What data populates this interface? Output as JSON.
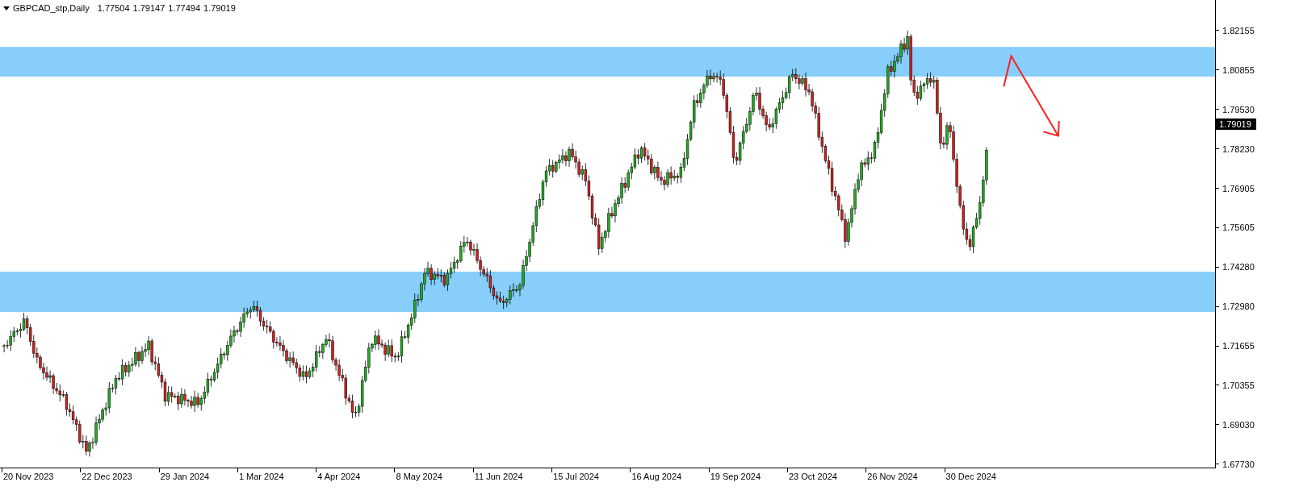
{
  "header": {
    "symbol": "GBPCAD_stp,Daily",
    "ohlc": [
      "1.77504",
      "1.79147",
      "1.77494",
      "1.79019"
    ]
  },
  "price_axis": {
    "labels": [
      "1.82155",
      "1.80855",
      "1.79530",
      "1.78230",
      "1.76905",
      "1.75605",
      "1.74280",
      "1.72980",
      "1.71655",
      "1.70355",
      "1.69030",
      "1.67730"
    ]
  },
  "current_price": "1.79019",
  "time_axis": {
    "labels": [
      "20 Nov 2023",
      "22 Dec 2023",
      "29 Jan 2024",
      "1 Mar 2024",
      "4 Apr 2024",
      "8 May 2024",
      "11 Jun 2024",
      "15 Jul 2024",
      "16 Aug 2024",
      "19 Sep 2024",
      "23 Oct 2024",
      "26 Nov 2024",
      "30 Dec 2024"
    ]
  }
}
